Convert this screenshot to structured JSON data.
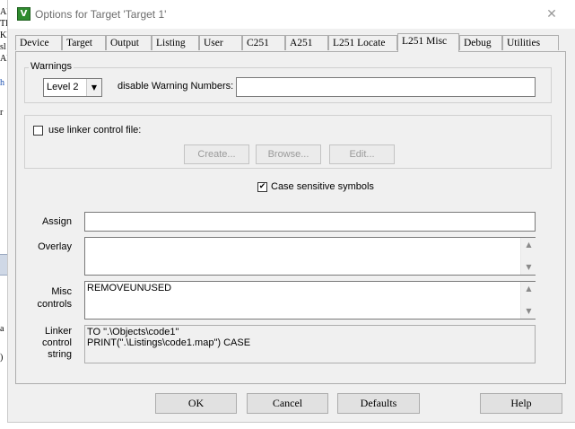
{
  "background": {
    "fragments": [
      "Al",
      "Tl",
      "Kl",
      "sl",
      "Al",
      "h",
      "r",
      "a",
      ")"
    ]
  },
  "window": {
    "title": "Options for Target 'Target 1'",
    "close_glyph": "✕",
    "app_icon": "µ-vision-icon"
  },
  "tabs": [
    {
      "label": "Device"
    },
    {
      "label": "Target"
    },
    {
      "label": "Output"
    },
    {
      "label": "Listing"
    },
    {
      "label": "User"
    },
    {
      "label": "C251"
    },
    {
      "label": "A251"
    },
    {
      "label": "L251 Locate"
    },
    {
      "label": "L251 Misc",
      "active": true
    },
    {
      "label": "Debug"
    },
    {
      "label": "Utilities"
    }
  ],
  "warnings": {
    "group_title": "Warnings",
    "level_value": "Level 2",
    "disable_label": "disable Warning Numbers:",
    "disable_value": ""
  },
  "linker_file": {
    "checkbox_label": "use linker control file:",
    "checked": false,
    "create_label": "Create...",
    "browse_label": "Browse...",
    "edit_label": "Edit..."
  },
  "case_sensitive": {
    "label": "Case sensitive symbols",
    "checked": true,
    "check_glyph": "✔"
  },
  "fields": {
    "assign_label": "Assign",
    "assign_value": "",
    "overlay_label": "Overlay",
    "overlay_value": "",
    "misc_label_line1": "Misc",
    "misc_label_line2": "controls",
    "misc_value": "REMOVEUNUSED",
    "linker_label_line1": "Linker",
    "linker_label_line2": "control",
    "linker_label_line3": "string",
    "linker_value": "TO \".\\Objects\\code1\"\nPRINT(\".\\Listings\\code1.map\") CASE"
  },
  "scroll": {
    "up": "▲",
    "down": "▼"
  },
  "footer": {
    "ok": "OK",
    "cancel": "Cancel",
    "defaults": "Defaults",
    "help": "Help"
  }
}
